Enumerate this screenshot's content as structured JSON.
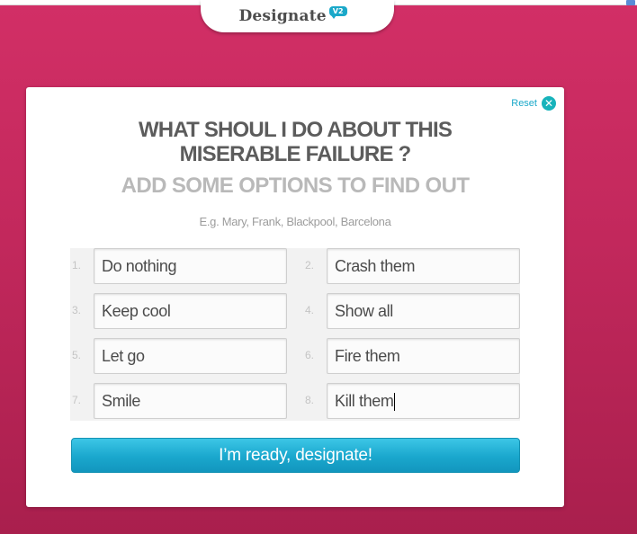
{
  "app": {
    "name": "Designate",
    "version_badge": "V2"
  },
  "reset": {
    "label": "Reset",
    "icon": "close-icon"
  },
  "question": "WHAT SHOUL I DO ABOUT THIS MISERABLE FAILURE ?",
  "subtitle": "ADD SOME OPTIONS TO FIND OUT",
  "hint": "E.g. Mary, Frank, Blackpool, Barcelona",
  "options": [
    {
      "number": "1.",
      "value": "Do nothing"
    },
    {
      "number": "2.",
      "value": "Crash them"
    },
    {
      "number": "3.",
      "value": "Keep cool"
    },
    {
      "number": "4.",
      "value": "Show all"
    },
    {
      "number": "5.",
      "value": "Let go"
    },
    {
      "number": "6.",
      "value": "Fire them"
    },
    {
      "number": "7.",
      "value": "Smile"
    },
    {
      "number": "8.",
      "value": "Kill them"
    }
  ],
  "submit_label": "I’m ready, designate!",
  "colors": {
    "background": "#c9295e",
    "accent": "#1aa8c9",
    "card": "#ffffff",
    "title_text": "#5c5c5c",
    "subtitle_text": "#b9b9b9"
  }
}
